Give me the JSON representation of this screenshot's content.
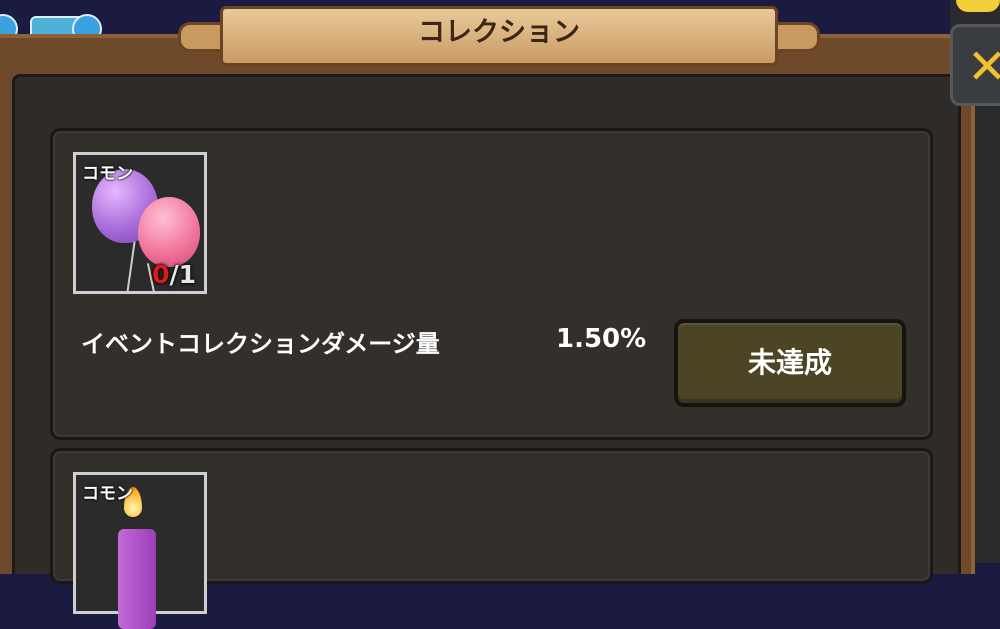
{
  "header": {
    "title": "コレクション"
  },
  "colors": {
    "frame_wood": "#6e4a2b",
    "panel_bg": "#2e2b28",
    "card_bg": "#332f2b",
    "status_button_bg": "#4b4526",
    "owned_count_color": "#e01818",
    "close_icon_color": "#f2c12e"
  },
  "collections": [
    {
      "rarity": "コモン",
      "icon": "balloons-icon",
      "owned": "0",
      "required": "/1",
      "effect_label": "イベントコレクションダメージ量",
      "effect_value": "1.50%",
      "status_label": "未達成"
    },
    {
      "rarity": "コモン",
      "icon": "candle-icon"
    }
  ],
  "icons": {
    "close": "close-icon"
  }
}
